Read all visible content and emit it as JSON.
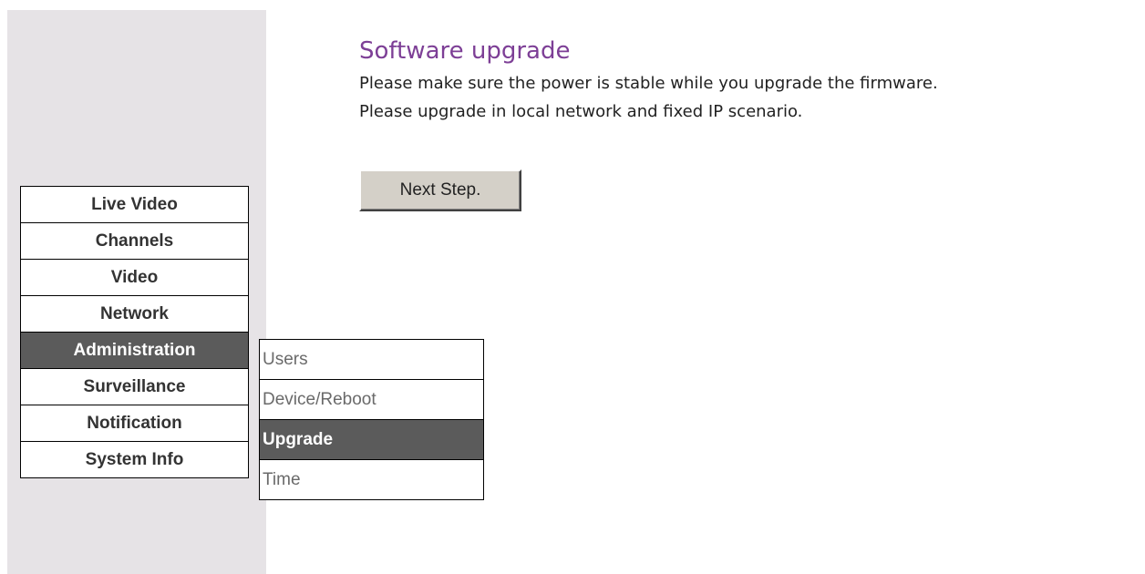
{
  "sidebar": {
    "menu": [
      {
        "label": "Live Video"
      },
      {
        "label": "Channels"
      },
      {
        "label": "Video"
      },
      {
        "label": "Network"
      },
      {
        "label": "Administration",
        "active": true
      },
      {
        "label": "Surveillance"
      },
      {
        "label": "Notification"
      },
      {
        "label": "System Info"
      }
    ],
    "submenu": [
      {
        "label": "Users"
      },
      {
        "label": "Device/Reboot"
      },
      {
        "label": "Upgrade",
        "active": true
      },
      {
        "label": "Time"
      }
    ]
  },
  "main": {
    "title": "Software upgrade",
    "notice_lines": [
      "Please make sure the power is stable while you upgrade the firmware.",
      "Please upgrade in local network and fixed IP scenario."
    ],
    "next_button_label": "Next Step."
  },
  "colors": {
    "title": "#7d3f96",
    "active_menu_bg": "#5b5b5b",
    "sidebar_bg": "#e6e3e6",
    "button_face": "#d4d0c8"
  }
}
